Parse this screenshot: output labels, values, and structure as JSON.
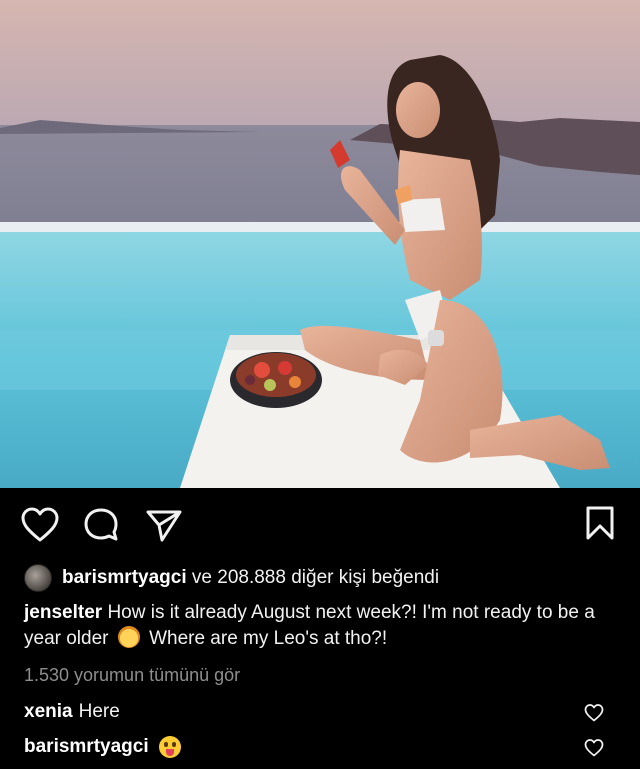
{
  "post": {
    "photo_icon": "photo-of-woman-by-infinity-pool",
    "actions": {
      "like_icon": "heart-icon",
      "comment_icon": "comment-bubble-icon",
      "share_icon": "paper-plane-icon",
      "save_icon": "bookmark-icon"
    },
    "likes": {
      "user": "barismrtyagci",
      "text": "ve 208.888 diğer kişi beğendi"
    },
    "caption": {
      "user": "jenselter",
      "text_part1": "How is it already August next week?! I'm not ready to be a year older",
      "text_part2": "Where are my Leo's at tho?!"
    },
    "view_all_comments": "1.530 yorumun tümünü gör",
    "comments": [
      {
        "user": "xenia",
        "text": "Here"
      },
      {
        "user": "barismrtyagci",
        "text": ""
      }
    ]
  },
  "colors": {
    "background": "#000000",
    "text": "#f2f2f2",
    "muted": "#8e8e8e"
  }
}
